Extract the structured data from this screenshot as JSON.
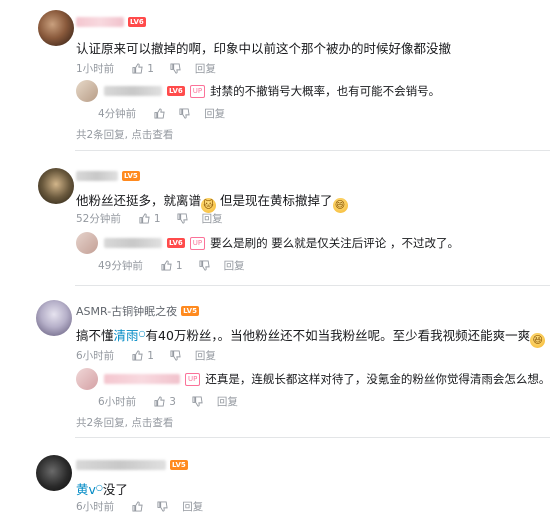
{
  "comments": [
    {
      "text": "认证原来可以撤掉的啊，印象中以前这个那个被办的时候好像都没撤",
      "level": "LV6",
      "time": "1小时前",
      "likes": "1",
      "reply_label": "回复",
      "reply": {
        "up_badge": "UP",
        "text": "封禁的不撤销号大概率，也有可能不会销号。",
        "time": "4分钟前",
        "reply_label": "回复"
      },
      "more_count": "共2条回复,",
      "more_link": "点击查看"
    },
    {
      "text_a": "他粉丝还挺多，就离谱",
      "text_b": "但是现在黄标撤掉了",
      "level": "LV5",
      "time": "52分钟前",
      "likes": "1",
      "reply_label": "回复",
      "reply": {
        "up_badge": "UP",
        "text": "要么是刷的 要么就是仅关注后评论 ，不过改了。",
        "time": "49分钟前",
        "likes": "1",
        "reply_label": "回复"
      }
    },
    {
      "username": "ASMR-古铜钟眠之夜",
      "level": "LV5",
      "text_a": "搞不懂",
      "text_hl": "清雨",
      "text_b": "有40万粉丝，。当他粉丝还不如当我粉丝呢。至少看我视频还能爽一爽",
      "time": "6小时前",
      "likes": "1",
      "reply_label": "回复",
      "reply": {
        "up_badge": "UP",
        "text": "还真是，连舰长都这样对待了，没氪金的粉丝你觉得清雨会怎么想。",
        "time": "6小时前",
        "likes": "3",
        "reply_label": "回复"
      },
      "more_count": "共2条回复,",
      "more_link": "点击查看"
    },
    {
      "level": "LV5",
      "text_hl": "黄v",
      "text_b": "没了",
      "time": "6小时前",
      "reply_label": "回复"
    }
  ],
  "icons": [
    "like-icon",
    "dislike-icon",
    "search-icon"
  ],
  "colors": {
    "link": "#008ac5",
    "meta": "#9499a0",
    "up_badge": "#fb7299",
    "lv5": "#ff8a1f",
    "lv6": "#ff4b4b"
  }
}
